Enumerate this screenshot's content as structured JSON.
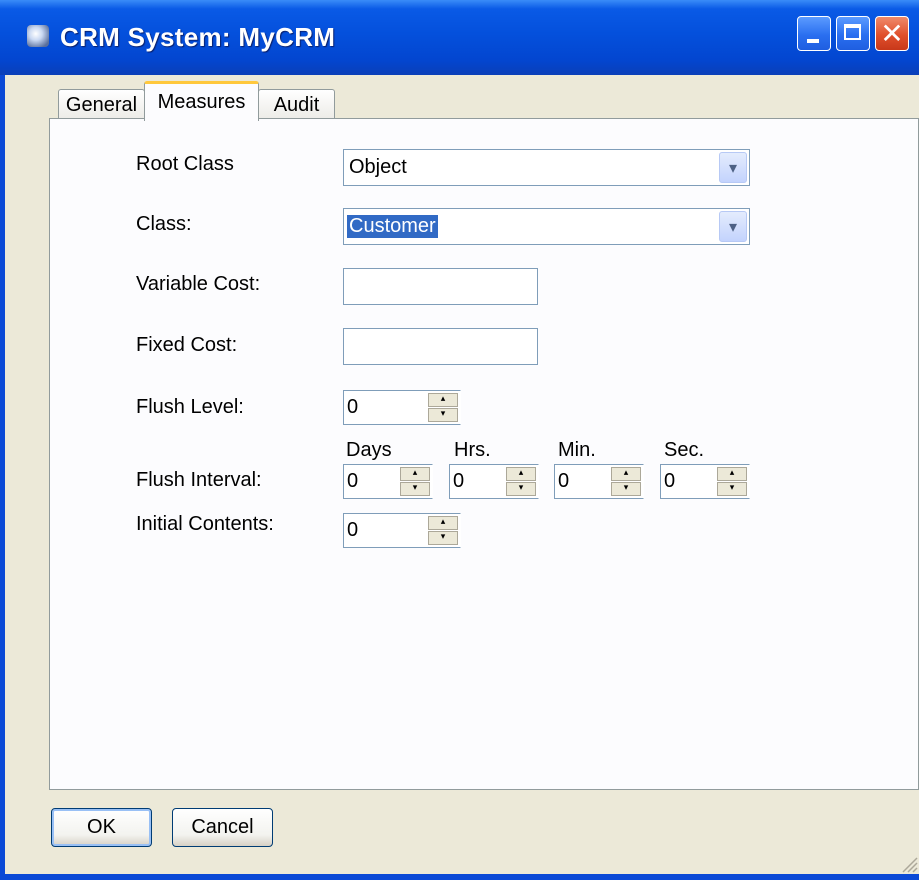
{
  "window": {
    "title": "CRM System: MyCRM",
    "minimize_label": "",
    "maximize_label": "",
    "close_label": "✕"
  },
  "tabs": [
    {
      "label": "General",
      "active": false
    },
    {
      "label": "Measures",
      "active": true
    },
    {
      "label": "Audit",
      "active": false
    }
  ],
  "form": {
    "root_class": {
      "label": "Root Class",
      "value": "Object"
    },
    "class": {
      "label": "Class:",
      "value": "Customer"
    },
    "variable_cost": {
      "label": "Variable Cost:",
      "value": ""
    },
    "fixed_cost": {
      "label": "Fixed Cost:",
      "value": ""
    },
    "flush_level": {
      "label": "Flush Level:",
      "value": "0"
    },
    "flush_interval": {
      "label": "Flush Interval:",
      "days": {
        "label": "Days",
        "value": "0"
      },
      "hrs": {
        "label": "Hrs.",
        "value": "0"
      },
      "min": {
        "label": "Min.",
        "value": "0"
      },
      "sec": {
        "label": "Sec.",
        "value": "0"
      }
    },
    "initial_contents": {
      "label": "Initial Contents:",
      "value": "0"
    }
  },
  "buttons": {
    "ok": "OK",
    "cancel": "Cancel"
  },
  "icons": {
    "dropdown": "▾",
    "spin_up": "▴",
    "spin_down": "▾"
  },
  "colors": {
    "title_bar": "#0450dc",
    "selection": "#316ac5",
    "active_tab_accent": "#ffc83c",
    "dialog_bg": "#ece9d8"
  }
}
